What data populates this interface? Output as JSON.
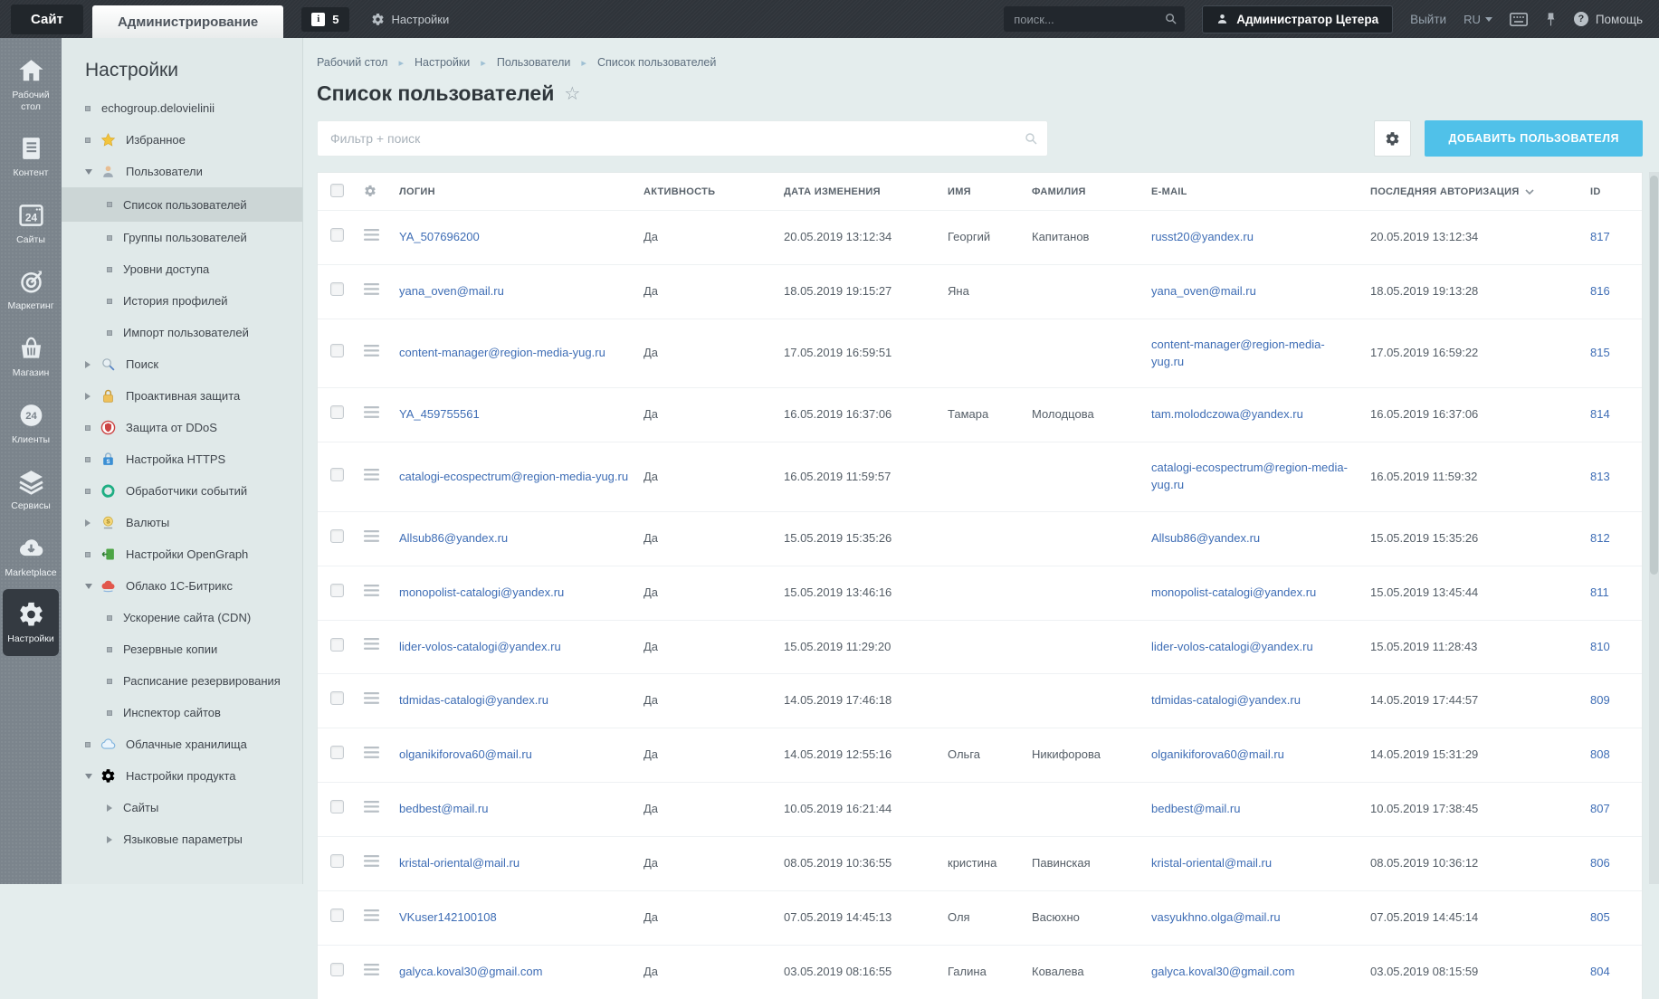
{
  "topbar": {
    "site_tab": "Сайт",
    "admin_tab": "Администрирование",
    "notifications_count": "5",
    "settings_label": "Настройки",
    "search_placeholder": "поиск...",
    "user_name": "Администратор Цетера",
    "logout_label": "Выйти",
    "language": "RU",
    "help_label": "Помощь"
  },
  "rail": {
    "items": [
      {
        "key": "desktop",
        "label": "Рабочий стол",
        "icon": "home-icon",
        "active": false
      },
      {
        "key": "content",
        "label": "Контент",
        "icon": "document-icon",
        "active": false
      },
      {
        "key": "sites",
        "label": "Сайты",
        "icon": "browser24-icon",
        "active": false
      },
      {
        "key": "marketing",
        "label": "Маркетинг",
        "icon": "target-icon",
        "active": false
      },
      {
        "key": "store",
        "label": "Магазин",
        "icon": "basket-icon",
        "active": false
      },
      {
        "key": "clients",
        "label": "Клиенты",
        "icon": "clients24-icon",
        "active": false
      },
      {
        "key": "services",
        "label": "Сервисы",
        "icon": "layers-icon",
        "active": false
      },
      {
        "key": "marketplace",
        "label": "Marketplace",
        "icon": "cloud-download-icon",
        "active": false
      },
      {
        "key": "settings",
        "label": "Настройки",
        "icon": "gear-icon",
        "active": true
      }
    ]
  },
  "sidebar": {
    "title": "Настройки",
    "items": [
      {
        "key": "site-name",
        "label": "echogroup.delovielinii",
        "marker": "bullet"
      },
      {
        "key": "favorites",
        "label": "Избранное",
        "marker": "bullet",
        "icon": "star-icon"
      },
      {
        "key": "users",
        "label": "Пользователи",
        "marker": "expanded",
        "icon": "user-icon",
        "children": [
          {
            "key": "user-list",
            "label": "Список пользователей",
            "marker": "bullet",
            "active": true
          },
          {
            "key": "user-groups",
            "label": "Группы пользователей",
            "marker": "bullet"
          },
          {
            "key": "access-levels",
            "label": "Уровни доступа",
            "marker": "bullet"
          },
          {
            "key": "profile-history",
            "label": "История профилей",
            "marker": "bullet"
          },
          {
            "key": "user-import",
            "label": "Импорт пользователей",
            "marker": "bullet"
          }
        ]
      },
      {
        "key": "search",
        "label": "Поиск",
        "marker": "collapsed",
        "icon": "search-icon"
      },
      {
        "key": "proactive-protection",
        "label": "Проактивная защита",
        "marker": "collapsed",
        "icon": "lock-icon"
      },
      {
        "key": "ddos",
        "label": "Защита от DDoS",
        "marker": "bullet",
        "icon": "shield-icon"
      },
      {
        "key": "https",
        "label": "Настройка HTTPS",
        "marker": "bullet",
        "icon": "https-lock-icon"
      },
      {
        "key": "event-handlers",
        "label": "Обработчики событий",
        "marker": "bullet",
        "icon": "event-handlers-icon"
      },
      {
        "key": "currencies",
        "label": "Валюты",
        "marker": "collapsed",
        "icon": "currency-icon"
      },
      {
        "key": "opengraph",
        "label": "Настройки OpenGraph",
        "marker": "bullet",
        "icon": "opengraph-icon"
      },
      {
        "key": "bitrix-cloud",
        "label": "Облако 1С-Битрикс",
        "marker": "expanded",
        "icon": "cloud-bitrix-icon",
        "children": [
          {
            "key": "cdn",
            "label": "Ускорение сайта (CDN)",
            "marker": "bullet"
          },
          {
            "key": "backups",
            "label": "Резервные копии",
            "marker": "bullet"
          },
          {
            "key": "backup-schedule",
            "label": "Расписание резервирования",
            "marker": "bullet"
          },
          {
            "key": "site-inspector",
            "label": "Инспектор сайтов",
            "marker": "bullet"
          }
        ]
      },
      {
        "key": "cloud-storage",
        "label": "Облачные хранилища",
        "marker": "bullet",
        "icon": "cloud-storage-icon"
      },
      {
        "key": "product-settings",
        "label": "Настройки продукта",
        "marker": "expanded",
        "icon": "gear-small-icon",
        "children": [
          {
            "key": "sites-settings",
            "label": "Сайты",
            "marker": "collapsed"
          },
          {
            "key": "language-params",
            "label": "Языковые параметры",
            "marker": "collapsed"
          }
        ]
      }
    ]
  },
  "main": {
    "breadcrumb": [
      "Рабочий стол",
      "Настройки",
      "Пользователи",
      "Список пользователей"
    ],
    "page_title": "Список пользователей",
    "filter_placeholder": "Фильтр + поиск",
    "add_user_button": "ДОБАВИТЬ ПОЛЬЗОВАТЕЛЯ",
    "table": {
      "columns": [
        "ЛОГИН",
        "АКТИВНОСТЬ",
        "ДАТА ИЗМЕНЕНИЯ",
        "ИМЯ",
        "ФАМИЛИЯ",
        "E-MAIL",
        "ПОСЛЕДНЯЯ АВТОРИЗАЦИЯ",
        "ID"
      ],
      "sorted_column": "ПОСЛЕДНЯЯ АВТОРИЗАЦИЯ",
      "rows": [
        {
          "login": "YA_507696200",
          "active": "Да",
          "modified": "20.05.2019 13:12:34",
          "first_name": "Георгий",
          "last_name": "Капитанов",
          "email": "russt20@yandex.ru",
          "last_auth": "20.05.2019 13:12:34",
          "id": "817"
        },
        {
          "login": "yana_oven@mail.ru",
          "active": "Да",
          "modified": "18.05.2019 19:15:27",
          "first_name": "Яна",
          "last_name": "",
          "email": "yana_oven@mail.ru",
          "last_auth": "18.05.2019 19:13:28",
          "id": "816"
        },
        {
          "login": "content-manager@region-media-yug.ru",
          "active": "Да",
          "modified": "17.05.2019 16:59:51",
          "first_name": "",
          "last_name": "",
          "email": "content-manager@region-media-yug.ru",
          "last_auth": "17.05.2019 16:59:22",
          "id": "815"
        },
        {
          "login": "YA_459755561",
          "active": "Да",
          "modified": "16.05.2019 16:37:06",
          "first_name": "Тамара",
          "last_name": "Молодцова",
          "email": "tam.molodczowa@yandex.ru",
          "last_auth": "16.05.2019 16:37:06",
          "id": "814"
        },
        {
          "login": "catalogi-ecospectrum@region-media-yug.ru",
          "active": "Да",
          "modified": "16.05.2019 11:59:57",
          "first_name": "",
          "last_name": "",
          "email": "catalogi-ecospectrum@region-media-yug.ru",
          "last_auth": "16.05.2019 11:59:32",
          "id": "813"
        },
        {
          "login": "Allsub86@yandex.ru",
          "active": "Да",
          "modified": "15.05.2019 15:35:26",
          "first_name": "",
          "last_name": "",
          "email": "Allsub86@yandex.ru",
          "last_auth": "15.05.2019 15:35:26",
          "id": "812"
        },
        {
          "login": "monopolist-catalogi@yandex.ru",
          "active": "Да",
          "modified": "15.05.2019 13:46:16",
          "first_name": "",
          "last_name": "",
          "email": "monopolist-catalogi@yandex.ru",
          "last_auth": "15.05.2019 13:45:44",
          "id": "811"
        },
        {
          "login": "lider-volos-catalogi@yandex.ru",
          "active": "Да",
          "modified": "15.05.2019 11:29:20",
          "first_name": "",
          "last_name": "",
          "email": "lider-volos-catalogi@yandex.ru",
          "last_auth": "15.05.2019 11:28:43",
          "id": "810"
        },
        {
          "login": "tdmidas-catalogi@yandex.ru",
          "active": "Да",
          "modified": "14.05.2019 17:46:18",
          "first_name": "",
          "last_name": "",
          "email": "tdmidas-catalogi@yandex.ru",
          "last_auth": "14.05.2019 17:44:57",
          "id": "809"
        },
        {
          "login": "olganikiforova60@mail.ru",
          "active": "Да",
          "modified": "14.05.2019 12:55:16",
          "first_name": "Ольга",
          "last_name": "Никифорова",
          "email": "olganikiforova60@mail.ru",
          "last_auth": "14.05.2019 15:31:29",
          "id": "808"
        },
        {
          "login": "bedbest@mail.ru",
          "active": "Да",
          "modified": "10.05.2019 16:21:44",
          "first_name": "",
          "last_name": "",
          "email": "bedbest@mail.ru",
          "last_auth": "10.05.2019 17:38:45",
          "id": "807"
        },
        {
          "login": "kristal-oriental@mail.ru",
          "active": "Да",
          "modified": "08.05.2019 10:36:55",
          "first_name": "кристина",
          "last_name": "Павинская",
          "email": "kristal-oriental@mail.ru",
          "last_auth": "08.05.2019 10:36:12",
          "id": "806"
        },
        {
          "login": "VKuser142100108",
          "active": "Да",
          "modified": "07.05.2019 14:45:13",
          "first_name": "Оля",
          "last_name": "Васюхно",
          "email": "vasyukhno.olga@mail.ru",
          "last_auth": "07.05.2019 14:45:14",
          "id": "805"
        },
        {
          "login": "galyca.koval30@gmail.com",
          "active": "Да",
          "modified": "03.05.2019 08:16:55",
          "first_name": "Галина",
          "last_name": "Ковалева",
          "email": "galyca.koval30@gmail.com",
          "last_auth": "03.05.2019 08:15:59",
          "id": "804"
        }
      ]
    }
  },
  "colors": {
    "accent_blue": "#50c1e9",
    "link_blue": "#3e6db5",
    "topbar_bg": "#2f343a",
    "rail_bg": "#7b848c",
    "sidebar_bg": "#e0e9e9",
    "content_bg": "#e4eded"
  }
}
